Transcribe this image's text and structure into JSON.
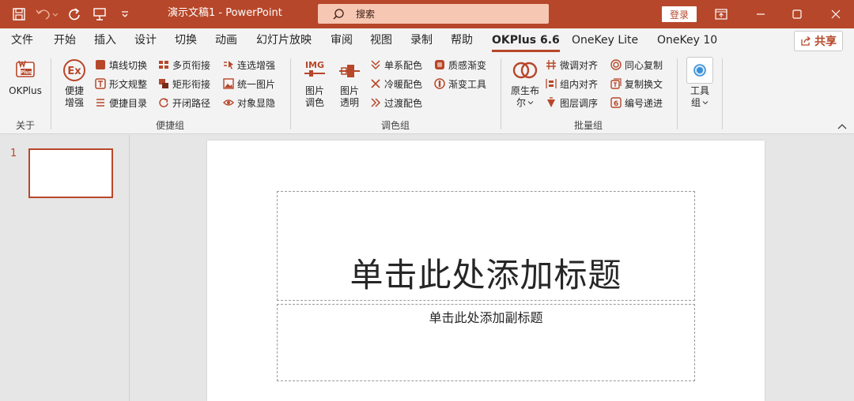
{
  "app": {
    "doc_title": "演示文稿1  -  PowerPoint",
    "search_placeholder": "搜索",
    "login_label": "登录",
    "accent": "#b7472a"
  },
  "menu": {
    "tabs": [
      {
        "label": "文件"
      },
      {
        "label": "开始"
      },
      {
        "label": "插入"
      },
      {
        "label": "设计"
      },
      {
        "label": "切换"
      },
      {
        "label": "动画"
      },
      {
        "label": "幻灯片放映"
      },
      {
        "label": "审阅"
      },
      {
        "label": "视图"
      },
      {
        "label": "录制"
      },
      {
        "label": "帮助"
      },
      {
        "label": "OKPlus 6.6"
      },
      {
        "label": "OneKey Lite"
      },
      {
        "label": "OneKey 10"
      }
    ],
    "active_tab": "OKPlus 6.6",
    "share_label": "共享"
  },
  "ribbon": {
    "groups": {
      "about": "关于",
      "quick": "便捷组",
      "color": "调色组",
      "batch": "批量组"
    },
    "okplus_label": "OKPlus",
    "quick_enhance": [
      "便捷",
      "增强"
    ],
    "quick_items": [
      "填线切换",
      "形文规整",
      "便捷目录",
      "多页衔接",
      "矩形衔接",
      "开闭路径",
      "连选增强",
      "统一图片",
      "对象显隐"
    ],
    "img_color": [
      "图片",
      "调色"
    ],
    "img_transparent": [
      "图片",
      "透明"
    ],
    "color_items": [
      "单系配色",
      "冷暖配色",
      "过渡配色",
      "质感渐变",
      "渐变工具"
    ],
    "bool_label": [
      "原生布",
      "尔"
    ],
    "batch_items": [
      "微调对齐",
      "组内对齐",
      "图层调序",
      "同心复制",
      "复制换文",
      "编号递进"
    ],
    "tools_label": [
      "工具",
      "组"
    ]
  },
  "thumbs": {
    "slide_number": "1"
  },
  "slide": {
    "title_placeholder": "单击此处添加标题",
    "subtitle_placeholder": "单击此处添加副标题"
  }
}
